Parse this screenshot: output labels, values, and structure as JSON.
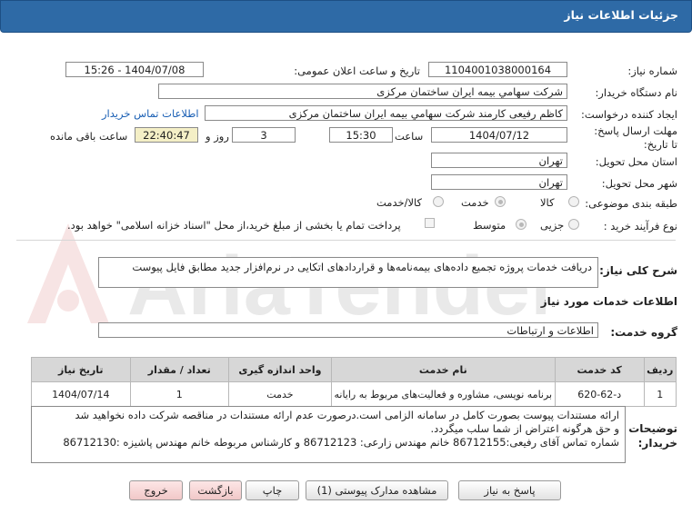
{
  "header": {
    "title": "جزئیات اطلاعات نیاز"
  },
  "watermark": "AriaTender.net",
  "form": {
    "need_number_label": "شماره نیاز:",
    "need_number": "1104001038000164",
    "announce_label": "تاریخ و ساعت اعلان عمومی:",
    "announce_value": "1404/07/08 - 15:26",
    "buyer_org_label": "نام دستگاه خریدار:",
    "buyer_org": "شرکت سهامي بيمه ايران ساختمان مرکزی",
    "creator_label": "ایجاد کننده درخواست:",
    "creator": "کاظم رفیعی کارمند شرکت سهامي بيمه ايران ساختمان مرکزی",
    "contact_link": "اطلاعات تماس خریدار",
    "deadline_label": "مهلت ارسال پاسخ: تا تاریخ:",
    "deadline_date": "1404/07/12",
    "time_label": "ساعت",
    "deadline_time": "15:30",
    "days_value": "3",
    "days_label": "روز و",
    "remaining_time": "22:40:47",
    "remaining_label": "ساعت باقی مانده",
    "province_label": "استان محل تحویل:",
    "province": "تهران",
    "city_label": "شهر محل تحویل:",
    "city": "تهران",
    "category_label": "طبقه بندی موضوعی:",
    "category_options": [
      "کالا",
      "خدمت",
      "کالا/خدمت"
    ],
    "purchase_type_label": "نوع فرآیند خرید :",
    "purchase_options": [
      "جزیی",
      "متوسط"
    ],
    "payment_note": "پرداخت تمام یا بخشی از مبلغ خرید،از محل \"اسناد خزانه اسلامی\" خواهد بود."
  },
  "description": {
    "label": "شرح کلی نیاز:",
    "text": "دریافت خدمات پروژه تجمیع داده‌های بیمه‌نامه‌ها و قراردادهای اتکایی در نرم‌افزار جدید مطابق فایل پیوست"
  },
  "services": {
    "section_title": "اطلاعات خدمات مورد نیاز",
    "group_label": "گروه خدمت:",
    "group_value": "اطلاعات و ارتباطات",
    "columns": [
      "ردیف",
      "کد خدمت",
      "نام خدمت",
      "واحد اندازه گیری",
      "تعداد / مقدار",
      "تاریخ نیاز"
    ],
    "rows": [
      [
        "1",
        "د-62-620",
        "برنامه نویسی، مشاوره و فعالیت‌های مربوط به رایانه",
        "خدمت",
        "1",
        "1404/07/14"
      ]
    ]
  },
  "buyer_notes": {
    "label": "توضیحات خریدار:",
    "lines": [
      "ارائه مستندات پیوست بصورت کامل در سامانه الزامی است.درصورت عدم ارائه مستندات در مناقصه شرکت داده نخواهید شد",
      "و حق هرگونه اعتراض از شما سلب میگردد.",
      "شماره تماس آقای رفیعی:86712155  خانم مهندس زارعی: 86712123 و کارشناس مربوطه خانم مهندس پاشیزه :86712130"
    ]
  },
  "buttons": {
    "reply": "پاسخ به نیاز",
    "attachments": "مشاهده مدارک پیوستی (1)",
    "print": "چاپ",
    "back": "بازگشت",
    "exit": "خروج"
  }
}
